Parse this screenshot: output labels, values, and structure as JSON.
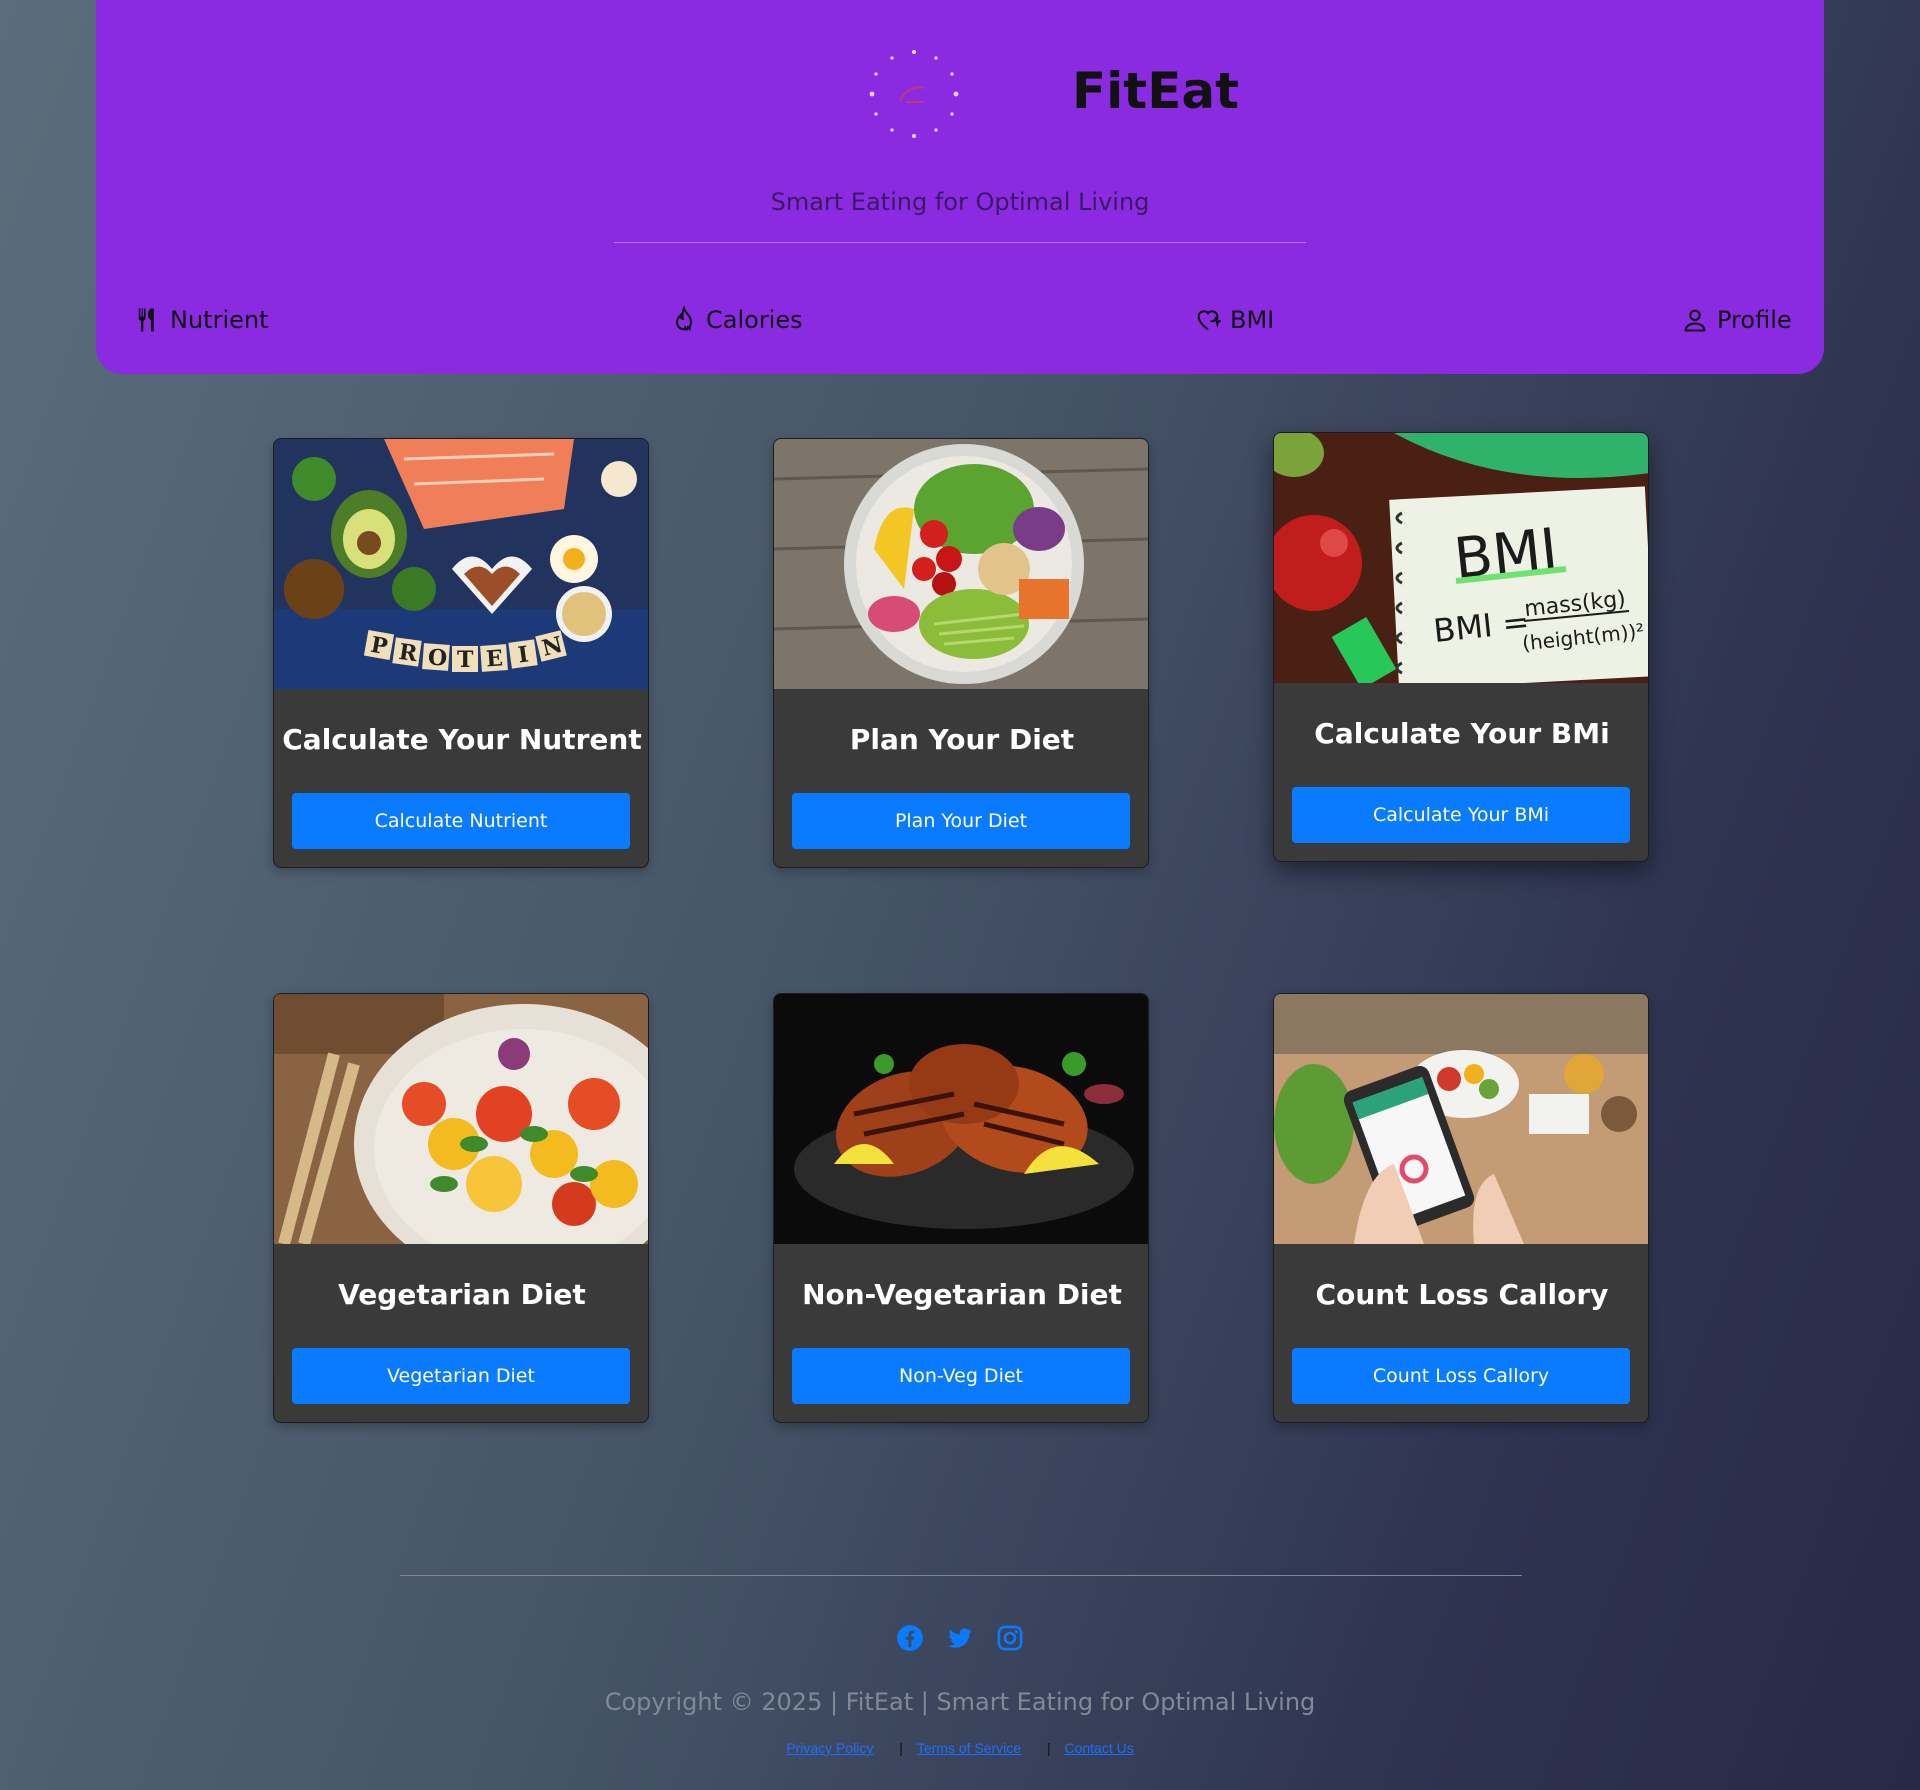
{
  "header": {
    "brand": "FitEat",
    "tagline": "Smart Eating for Optimal Living",
    "logo_icon": "spinning-logo-icon",
    "nav": [
      {
        "label": "Nutrient",
        "icon": "fork-knife-icon"
      },
      {
        "label": "Calories",
        "icon": "flame-icon"
      },
      {
        "label": "BMI",
        "icon": "heart-pulse-icon"
      },
      {
        "label": "Profile",
        "icon": "person-icon"
      }
    ]
  },
  "cards": [
    {
      "title": "Calculate Your Nutrent",
      "button": "Calculate Nutrient",
      "image": "protein-foods-image"
    },
    {
      "title": "Plan Your Diet",
      "button": "Plan Your Diet",
      "image": "salad-bowl-image"
    },
    {
      "title": "Calculate Your BMi",
      "button": "Calculate Your BMi",
      "image": "bmi-notebook-image",
      "image_text": {
        "heading": "BMI",
        "formula_left": "BMI =",
        "numerator": "mass(kg)",
        "denominator": "(height(m))²"
      }
    },
    {
      "title": "Vegetarian Diet",
      "button": "Vegetarian Diet",
      "image": "tomato-salad-image"
    },
    {
      "title": "Non-Vegetarian Diet",
      "button": "Non-Veg Diet",
      "image": "grilled-chicken-image"
    },
    {
      "title": "Count Loss Callory",
      "button": "Count Loss Callory",
      "image": "phone-calorie-app-image"
    }
  ],
  "footer": {
    "social": [
      "facebook-icon",
      "twitter-icon",
      "instagram-icon"
    ],
    "copyright": "Copyright © 2025 | FitEat | Smart Eating for Optimal Living",
    "links": [
      "Privacy Policy",
      "Terms of Service",
      "Contact Us"
    ],
    "separator": "|"
  },
  "colors": {
    "header_bg": "#8a2be2",
    "button_bg": "#0a7bff",
    "card_bg": "#3a3a3b",
    "link": "#1b6fff"
  }
}
